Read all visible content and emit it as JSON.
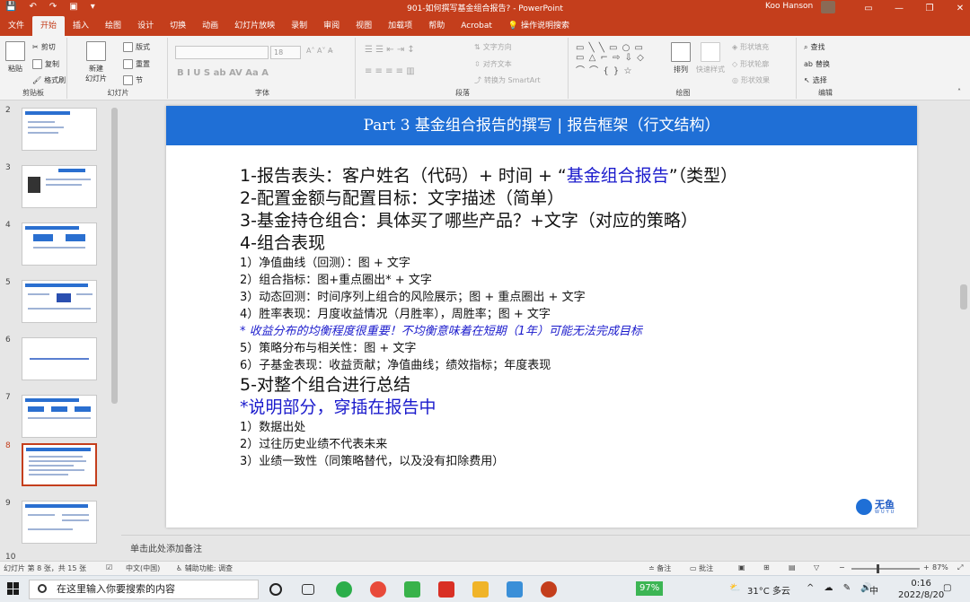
{
  "window": {
    "title": "901-如何撰写基金组合报告? - PowerPoint",
    "user": "Koo Hanson",
    "qat": [
      "💾",
      "↶",
      "↷",
      "▣",
      "▾"
    ],
    "controls": [
      "▭",
      "—",
      "❐",
      "✕"
    ]
  },
  "tabs": [
    "文件",
    "开始",
    "插入",
    "绘图",
    "设计",
    "切换",
    "动画",
    "幻灯片放映",
    "录制",
    "审阅",
    "视图",
    "加载项",
    "帮助",
    "Acrobat",
    "操作说明搜索"
  ],
  "ribbon": {
    "clipboard": {
      "label": "剪贴板",
      "paste": "粘贴",
      "cut": "剪切",
      "copy": "复制",
      "format_painter": "格式刷"
    },
    "slides": {
      "label": "幻灯片",
      "new_slide": "新建\n幻灯片",
      "layout": "版式",
      "reset": "重置",
      "section": "节"
    },
    "font": {
      "label": "字体",
      "size": "18"
    },
    "paragraph": {
      "label": "段落",
      "text_direction": "文字方向",
      "align_text": "对齐文本",
      "smartart": "转换为 SmartArt"
    },
    "drawing": {
      "label": "绘图",
      "arrange": "排列",
      "quick_styles": "快速样式",
      "shape_fill": "形状填充",
      "shape_outline": "形状轮廓",
      "shape_effects": "形状效果"
    },
    "editing": {
      "label": "编辑",
      "find": "查找",
      "replace": "替换",
      "select": "选择"
    }
  },
  "thumbnails": [
    {
      "num": "2",
      "selected": false
    },
    {
      "num": "3",
      "selected": false
    },
    {
      "num": "4",
      "selected": false
    },
    {
      "num": "5",
      "selected": false
    },
    {
      "num": "6",
      "selected": false
    },
    {
      "num": "7",
      "selected": false
    },
    {
      "num": "8",
      "selected": true
    },
    {
      "num": "9",
      "selected": false
    },
    {
      "num": "10",
      "selected": false
    }
  ],
  "slide": {
    "title": "Part 3 基金组合报告的撰写 | 报告框架（行文结构）",
    "line1_a": "1-报告表头：客户姓名（代码）+ 时间 + “",
    "line1_b": "基金组合报告",
    "line1_c": "”（类型）",
    "line2": "2-配置金额与配置目标：文字描述（简单）",
    "line3": "3-基金持仓组合：具体买了哪些产品？+文字（对应的策略）",
    "line4": "4-组合表现",
    "sub4_1": "1）净值曲线（回测）：图 + 文字",
    "sub4_2": "2）组合指标：图+重点圈出* + 文字",
    "sub4_3": "3）动态回测：时间序列上组合的风险展示；图 + 重点圈出 + 文字",
    "sub4_4": "4）胜率表现：月度收益情况（月胜率），周胜率；图 + 文字",
    "note": "* 收益分布的均衡程度很重要！不均衡意味着在短期（1年）可能无法完成目标",
    "sub4_5": "5）策略分布与相关性：图 + 文字",
    "sub4_6": "6）子基金表现：收益贡献；净值曲线；绩效指标；年度表现",
    "line5": "5-对整个组合进行总结",
    "explain": "*说明部分，穿插在报告中",
    "ex1": "1）数据出处",
    "ex2": "2）过往历史业绩不代表未来",
    "ex3": "3）业绩一致性（同策略替代，以及没有扣除费用）",
    "logo": "无鱼",
    "logo_sub": "WUYU"
  },
  "notes_placeholder": "单击此处添加备注",
  "status": {
    "slide_info": "幻灯片 第 8 张，共 15 张",
    "language": "中文(中国)",
    "accessibility": "辅助功能: 调查",
    "notes": "备注",
    "comments": "批注",
    "zoom": "87%"
  },
  "taskbar": {
    "search_placeholder": "在这里输入你要搜索的内容",
    "battery": "97%",
    "weather": "31°C 多云",
    "time": "0:16",
    "date": "2022/8/20",
    "ime": "中"
  }
}
